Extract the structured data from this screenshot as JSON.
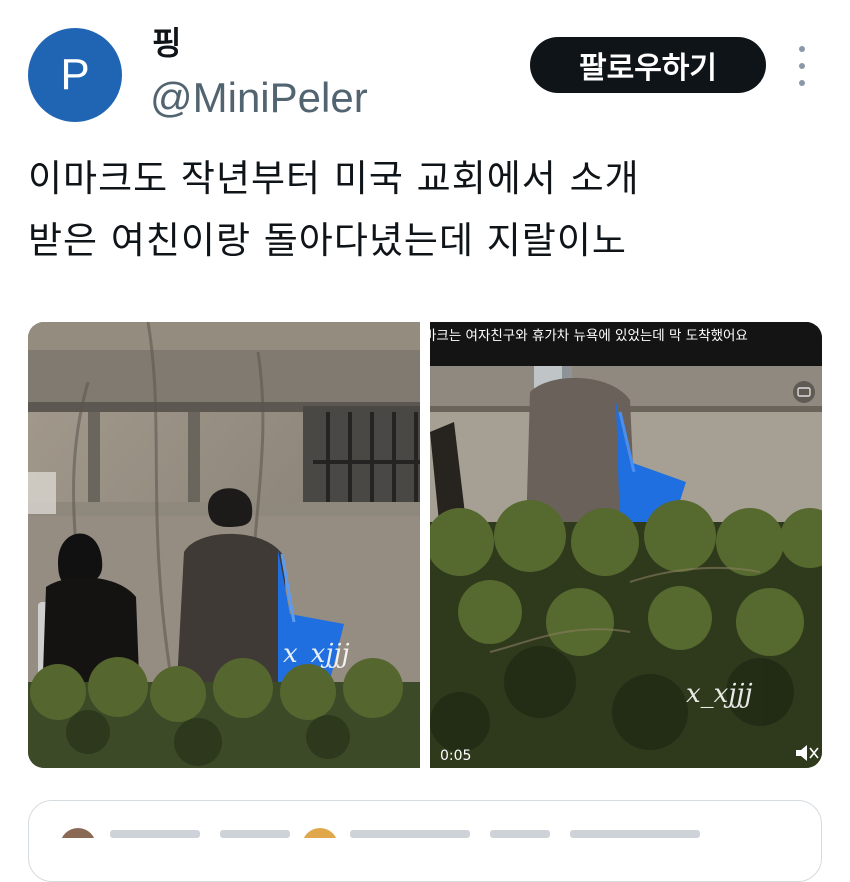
{
  "author": {
    "display_name": "핑",
    "handle": "@MiniPeler",
    "avatar_letter": "P",
    "avatar_color": "#1f65b4"
  },
  "follow_button": {
    "label": "팔로우하기"
  },
  "more_button": {
    "icon": "more-vertical-icon"
  },
  "tweet": {
    "line1": "이마크도 작년부터 미국 교회에서 소개",
    "line2": "받은 여친이랑 돌아다녔는데 지랄이노"
  },
  "media": {
    "left_photo": {
      "watermark": "x_xjjj"
    },
    "right_video": {
      "caption": "마크는 여자친구와 휴가차 뉴욕에 있었는데 막 도착했어요",
      "watermark": "x_xjjj",
      "timestamp": "0:05",
      "gif_badge_icon": "gif-badge-icon",
      "mute_icon": "volume-mute-icon"
    }
  },
  "colors": {
    "bag_blue": "#1f6fe0",
    "follow_bg": "#0f1419",
    "handle_gray": "#536471"
  }
}
